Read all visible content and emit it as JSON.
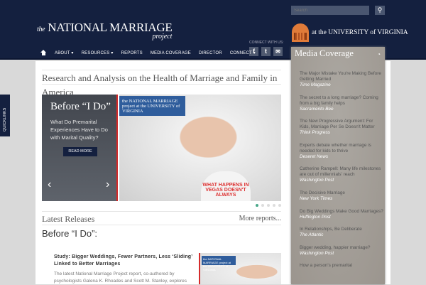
{
  "header": {
    "logo_the": "the",
    "logo_main": "NATIONAL MARRIAGE",
    "logo_sub": "project",
    "search_placeholder": "Search",
    "uva": "at the UNIVERSITY of VIRGINIA",
    "connect_label": "CONNECT WITH US:",
    "nav": [
      "ABOUT ▾",
      "RESOURCES ▾",
      "REPORTS",
      "MEDIA COVERAGE",
      "DIRECTOR",
      "CONNECT ▾"
    ]
  },
  "tagline": [
    "Research and Analysis on the Health of Marriage and Family in",
    "America"
  ],
  "slider": {
    "title": "Before “I Do”",
    "subtitle": "What Do Premarital Experiences Have to Do with Marital Quality?",
    "button": "READ MORE",
    "badge": "the NATIONAL MARRIAGE project at the UNIVERSITY of VIRGINIA",
    "onesie": "WHAT HAPPENS IN VEGAS DOESN'T ALWAYS"
  },
  "latest": {
    "title": "Latest Releases",
    "more": "More reports...",
    "heading": "Before “I Do”:",
    "study_title": "Study: Bigger Weddings, Fewer Partners, Less ‘Sliding’ Linked to Better Marriages",
    "study_desc": "The latest National Marriage Project report, co-authored by psychologists Galena K. Rhoades and Scott M. Stanley, explores"
  },
  "quicklinks": "QUICKLINKS",
  "sidebar": {
    "title": "Media Coverage",
    "items": [
      {
        "t": "The Major Mistake You're Making Before Getting Married",
        "s": "Time Magazine"
      },
      {
        "t": "The secret to a long marriage? Coming from a big family helps",
        "s": "Sacramento Bee"
      },
      {
        "t": "The New Progressive Argument: For Kids, Marriage Per Se Doesn't Matter",
        "s": "Think Progress"
      },
      {
        "t": "Experts debate whether marriage is needed for kids to thrive",
        "s": "Deseret News"
      },
      {
        "t": "Catherine Rampell: Many life milestones are out of millennials' reach",
        "s": "Washington Post"
      },
      {
        "t": "The Decisive Marriage",
        "s": "New York Times"
      },
      {
        "t": "Do Big Weddings Make Good Marriages?",
        "s": "Huffington Post"
      },
      {
        "t": "In Relationships, Be Deliberate",
        "s": "The Atlantic"
      },
      {
        "t": "Bigger wedding, happier marriage?",
        "s": "Washington Post"
      },
      {
        "t": "How a person's premarital",
        "s": ""
      }
    ]
  }
}
